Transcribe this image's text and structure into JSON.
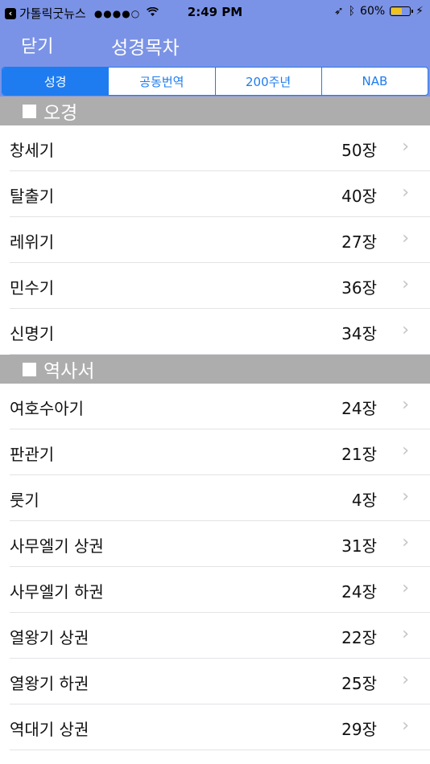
{
  "status_bar": {
    "back_app": "가톨릭굿뉴스",
    "signal": "●●●●○",
    "time": "2:49 PM",
    "battery_text": "60%",
    "battery_level": 0.6
  },
  "nav": {
    "close_label": "닫기",
    "title": "성경목차"
  },
  "tabs": [
    {
      "label": "성경",
      "active": true
    },
    {
      "label": "공동번역",
      "active": false
    },
    {
      "label": "200주년",
      "active": false
    },
    {
      "label": "NAB",
      "active": false
    }
  ],
  "sections": [
    {
      "title": "오경",
      "rows": [
        {
          "name": "창세기",
          "count": "50장"
        },
        {
          "name": "탈출기",
          "count": "40장"
        },
        {
          "name": "레위기",
          "count": "27장"
        },
        {
          "name": "민수기",
          "count": "36장"
        },
        {
          "name": "신명기",
          "count": "34장"
        }
      ]
    },
    {
      "title": "역사서",
      "rows": [
        {
          "name": "여호수아기",
          "count": "24장"
        },
        {
          "name": "판관기",
          "count": "21장"
        },
        {
          "name": "룻기",
          "count": "4장"
        },
        {
          "name": "사무엘기 상권",
          "count": "31장"
        },
        {
          "name": "사무엘기 하권",
          "count": "24장"
        },
        {
          "name": "열왕기 상권",
          "count": "22장"
        },
        {
          "name": "열왕기 하권",
          "count": "25장"
        },
        {
          "name": "역대기 상권",
          "count": "29장"
        }
      ]
    }
  ],
  "icons": {
    "chevron": "chevron-right-icon",
    "section_marker": "white-square-icon"
  }
}
